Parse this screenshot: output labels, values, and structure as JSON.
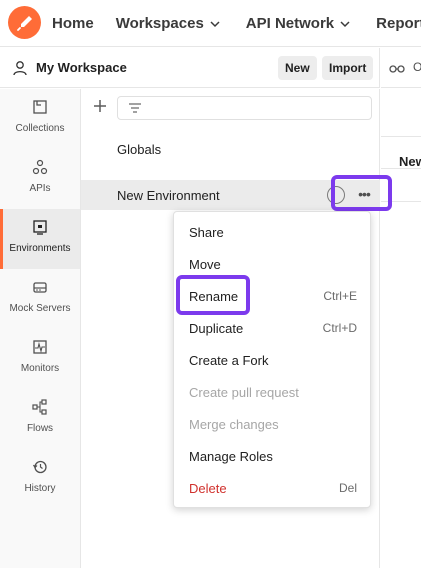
{
  "topnav": {
    "home": "Home",
    "workspaces": "Workspaces",
    "api_network": "API Network",
    "reports": "Reports"
  },
  "workspace": {
    "title": "My Workspace",
    "new_label": "New",
    "import_label": "Import"
  },
  "right_panel": {
    "tab_text": "O",
    "header_text": "New"
  },
  "sidebar": {
    "items": [
      {
        "label": "Collections",
        "icon": "collections-icon"
      },
      {
        "label": "APIs",
        "icon": "apis-icon"
      },
      {
        "label": "Environments",
        "icon": "environments-icon",
        "active": true
      },
      {
        "label": "Mock Servers",
        "icon": "mock-servers-icon"
      },
      {
        "label": "Monitors",
        "icon": "monitors-icon"
      },
      {
        "label": "Flows",
        "icon": "flows-icon"
      },
      {
        "label": "History",
        "icon": "history-icon"
      }
    ]
  },
  "environments": {
    "globals": "Globals",
    "items": [
      {
        "name": "New Environment",
        "selected": true
      }
    ],
    "more_icon": "•••"
  },
  "context_menu": {
    "items": [
      {
        "label": "Share",
        "shortcut": ""
      },
      {
        "label": "Move",
        "shortcut": ""
      },
      {
        "label": "Rename",
        "shortcut": "Ctrl+E"
      },
      {
        "label": "Duplicate",
        "shortcut": "Ctrl+D"
      },
      {
        "label": "Create a Fork",
        "shortcut": ""
      },
      {
        "label": "Create pull request",
        "shortcut": "",
        "disabled": true
      },
      {
        "label": "Merge changes",
        "shortcut": "",
        "disabled": true
      },
      {
        "label": "Manage Roles",
        "shortcut": ""
      },
      {
        "label": "Delete",
        "shortcut": "Del",
        "danger": true
      }
    ]
  },
  "colors": {
    "brand": "#ff6c37",
    "highlight": "#7c3aed",
    "danger": "#d0312d"
  }
}
